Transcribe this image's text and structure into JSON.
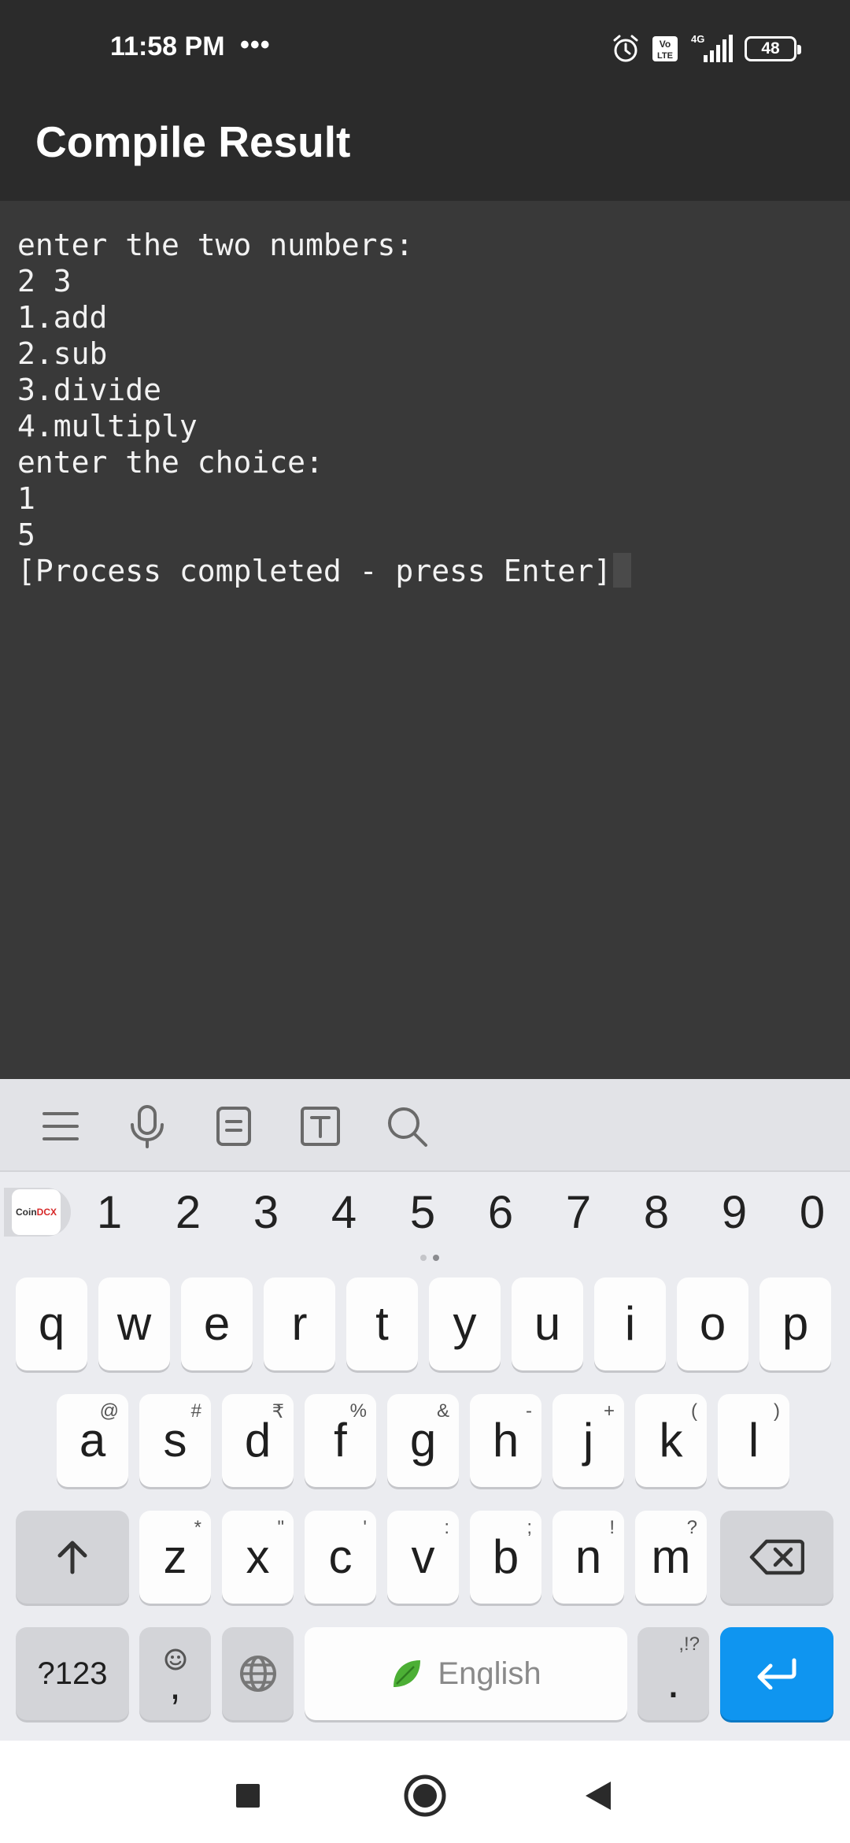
{
  "status_bar": {
    "time": "11:58 PM",
    "dots": "•••",
    "network_label": "4G",
    "volte_label": "Vo LTE",
    "battery_level": "48",
    "icons": [
      "alarm-icon",
      "volte-icon",
      "signal-4g-icon",
      "battery-icon"
    ]
  },
  "app_bar": {
    "title": "Compile Result"
  },
  "console": {
    "lines": [
      "enter the two numbers:",
      "2 3",
      "1.add",
      "2.sub",
      "3.divide",
      "4.multiply",
      "enter the choice:",
      "1",
      "5",
      "[Process completed - press Enter]"
    ]
  },
  "keyboard": {
    "toolbar_icons": [
      "menu-icon",
      "microphone-icon",
      "clipboard-icon",
      "text-format-icon",
      "search-icon"
    ],
    "badge": {
      "part1": "Coin",
      "part2": "DCX"
    },
    "numbers": [
      "1",
      "2",
      "3",
      "4",
      "5",
      "6",
      "7",
      "8",
      "9",
      "0"
    ],
    "row1": [
      {
        "key": "q"
      },
      {
        "key": "w"
      },
      {
        "key": "e"
      },
      {
        "key": "r"
      },
      {
        "key": "t"
      },
      {
        "key": "y"
      },
      {
        "key": "u"
      },
      {
        "key": "i"
      },
      {
        "key": "o"
      },
      {
        "key": "p"
      }
    ],
    "row2": [
      {
        "key": "a",
        "alt": "@"
      },
      {
        "key": "s",
        "alt": "#"
      },
      {
        "key": "d",
        "alt": "₹"
      },
      {
        "key": "f",
        "alt": "%"
      },
      {
        "key": "g",
        "alt": "&"
      },
      {
        "key": "h",
        "alt": "-"
      },
      {
        "key": "j",
        "alt": "+"
      },
      {
        "key": "k",
        "alt": "("
      },
      {
        "key": "l",
        "alt": ")"
      }
    ],
    "row3": [
      {
        "key": "z",
        "alt": "*"
      },
      {
        "key": "x",
        "alt": "\""
      },
      {
        "key": "c",
        "alt": "'"
      },
      {
        "key": "v",
        "alt": ":"
      },
      {
        "key": "b",
        "alt": ";"
      },
      {
        "key": "n",
        "alt": "!"
      },
      {
        "key": "m",
        "alt": "?"
      }
    ],
    "symbols_label": "?123",
    "emoji_comma": ",",
    "space_label": "English",
    "period_label": ".",
    "period_alt": ",!?",
    "accent_color": "#0f95f0"
  },
  "nav_bar": {
    "icons": [
      "recents-square-icon",
      "home-circle-icon",
      "back-triangle-icon"
    ]
  }
}
